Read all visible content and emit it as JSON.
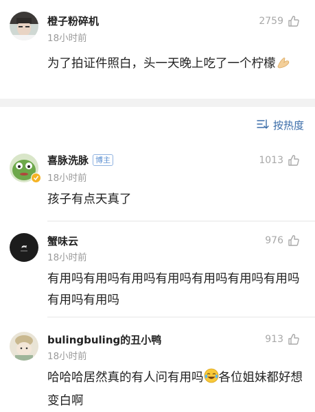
{
  "top_comment": {
    "username": "橙子粉碎机",
    "time": "18小时前",
    "likes": "2759",
    "text": "为了拍证件照白，头一天晚上吃了一个柠檬"
  },
  "sort": {
    "label": "按热度"
  },
  "comments": [
    {
      "username": "喜脉洗脉",
      "badge": "博主",
      "time": "18小时前",
      "likes": "1013",
      "text": "孩子有点天真了"
    },
    {
      "username": "蟹味云",
      "time": "18小时前",
      "likes": "976",
      "text": "有用吗有用吗有用吗有用吗有用吗有用吗有用吗有用吗有用吗"
    },
    {
      "username": "bulingbuling的丑小鸭",
      "time": "18小时前",
      "likes": "913",
      "text_before_emoji": "哈哈哈居然真的有人问有用吗",
      "text_after_emoji": "各位姐妹都好想变白啊"
    }
  ],
  "colors": {
    "accent_blue": "#3a6ca8",
    "muted_gray": "#9a9a9a",
    "separator": "#f2f2f2"
  }
}
